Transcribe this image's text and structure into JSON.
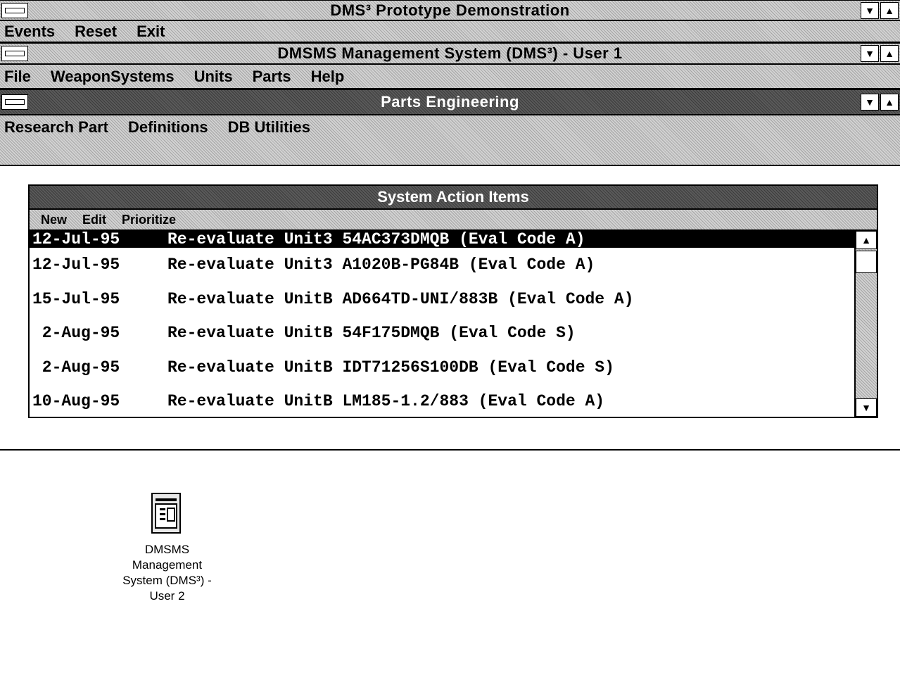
{
  "windows": {
    "outer": {
      "title": "DMS³ Prototype Demonstration",
      "menu": [
        "Events",
        "Reset",
        "Exit"
      ]
    },
    "dms": {
      "title": "DMSMS Management System (DMS³) - User 1",
      "menu": [
        "File",
        "WeaponSystems",
        "Units",
        "Parts",
        "Help"
      ]
    },
    "parts": {
      "title": "Parts Engineering",
      "menu": [
        "Research Part",
        "Definitions",
        "DB Utilities"
      ]
    }
  },
  "action_items": {
    "title": "System Action Items",
    "menu": [
      "New",
      "Edit",
      "Prioritize"
    ],
    "rows": [
      {
        "date": "12-Jul-95",
        "text": "Re-evaluate Unit3 54AC373DMQB (Eval Code A)",
        "selected": true
      },
      {
        "date": "12-Jul-95",
        "text": "Re-evaluate Unit3 A1020B-PG84B (Eval Code A)"
      },
      {
        "date": "15-Jul-95",
        "text": "Re-evaluate UnitB AD664TD-UNI/883B (Eval Code A)"
      },
      {
        "date": " 2-Aug-95",
        "text": "Re-evaluate UnitB 54F175DMQB (Eval Code S)"
      },
      {
        "date": " 2-Aug-95",
        "text": "Re-evaluate UnitB IDT71256S100DB (Eval Code S)"
      },
      {
        "date": "10-Aug-95",
        "text": "Re-evaluate UnitB LM185-1.2/883 (Eval Code A)"
      }
    ]
  },
  "desktop_icon": {
    "label": "DMSMS\nManagement\nSystem (DMS³) -\nUser 2",
    "icon": "application-window-icon"
  }
}
